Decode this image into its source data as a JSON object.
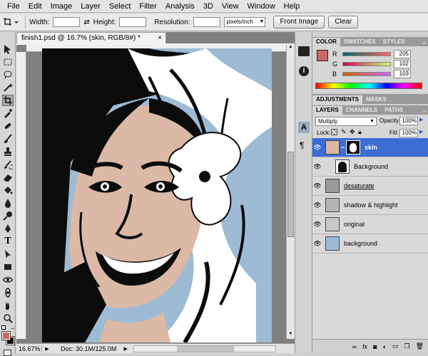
{
  "menu": [
    "File",
    "Edit",
    "Image",
    "Layer",
    "Select",
    "Filter",
    "Analysis",
    "3D",
    "View",
    "Window",
    "Help"
  ],
  "options": {
    "width_label": "Width:",
    "height_label": "Height:",
    "resolution_label": "Resolution:",
    "units": "pixels/inch",
    "front_image": "Front Image",
    "clear": "Clear"
  },
  "document": {
    "tab": "finish1.psd @ 16.7% (skin, RGB/8#) *",
    "zoom": "16.67%",
    "doc_info": "Doc: 30.1M/125.0M"
  },
  "color_panel": {
    "tabs": [
      "COLOR",
      "SWATCHES",
      "STYLES"
    ],
    "channels": [
      {
        "label": "R",
        "value": "205"
      },
      {
        "label": "G",
        "value": "102"
      },
      {
        "label": "B",
        "value": "103"
      }
    ],
    "foreground": "#cd6667",
    "background": "#1a0a0a"
  },
  "adjustments_panel": {
    "tabs": [
      "ADJUSTMENTS",
      "MASKS"
    ]
  },
  "layers_panel": {
    "tabs": [
      "LAYERS",
      "CHANNELS",
      "PATHS"
    ],
    "blend_mode": "Multiply",
    "opacity_label": "Opacity:",
    "opacity": "100%",
    "lock_label": "Lock:",
    "fill_label": "Fill:",
    "fill": "100%",
    "layers": [
      {
        "name": "skin",
        "selected": true,
        "thumb": "#dbb9a6"
      },
      {
        "name": "Background",
        "selected": false,
        "thumb": "#ffffff"
      },
      {
        "name": "desaturate",
        "selected": false,
        "thumb": "#9a9a9a"
      },
      {
        "name": "shadow & highlight",
        "selected": false,
        "thumb": "#b4b4b4"
      },
      {
        "name": "original",
        "selected": false,
        "thumb": "#c8c8c8"
      },
      {
        "name": "background",
        "selected": false,
        "thumb": "#9dbbd4"
      }
    ]
  },
  "colors": {
    "accent_selected": "#3b6dd4",
    "skin": "#dbb9a6",
    "sky": "#9dbbd4"
  }
}
